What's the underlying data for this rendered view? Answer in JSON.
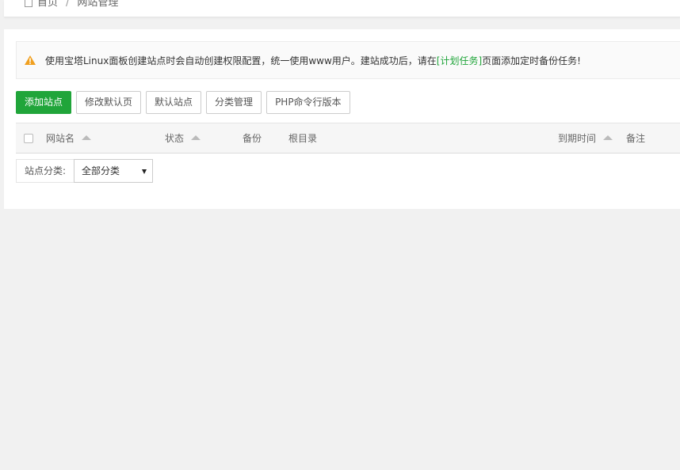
{
  "breadcrumb": {
    "home": "首页",
    "separator": "/",
    "current": "网站管理"
  },
  "notice": {
    "text_before": "使用宝塔Linux面板创建站点时会自动创建权限配置，统一使用www用户。建站成功后，请在",
    "link_text": "[计划任务]",
    "text_after": "页面添加定时备份任务!",
    "icon": "warning-icon",
    "icon_color": "#f0a020",
    "link_color": "#20a53a"
  },
  "toolbar": {
    "add_site": "添加站点",
    "edit_default_page": "修改默认页",
    "default_site": "默认站点",
    "category_manage": "分类管理",
    "php_cli_version": "PHP命令行版本"
  },
  "table": {
    "columns": [
      {
        "label": "网站名",
        "sortable": true
      },
      {
        "label": "状态",
        "sortable": true
      },
      {
        "label": "备份",
        "sortable": false
      },
      {
        "label": "根目录",
        "sortable": false
      },
      {
        "label": "到期时间",
        "sortable": true
      },
      {
        "label": "备注",
        "sortable": false
      }
    ]
  },
  "filter": {
    "label": "站点分类:",
    "selected": "全部分类"
  },
  "colors": {
    "accent": "#20a53a",
    "background": "#f1f1f1"
  }
}
